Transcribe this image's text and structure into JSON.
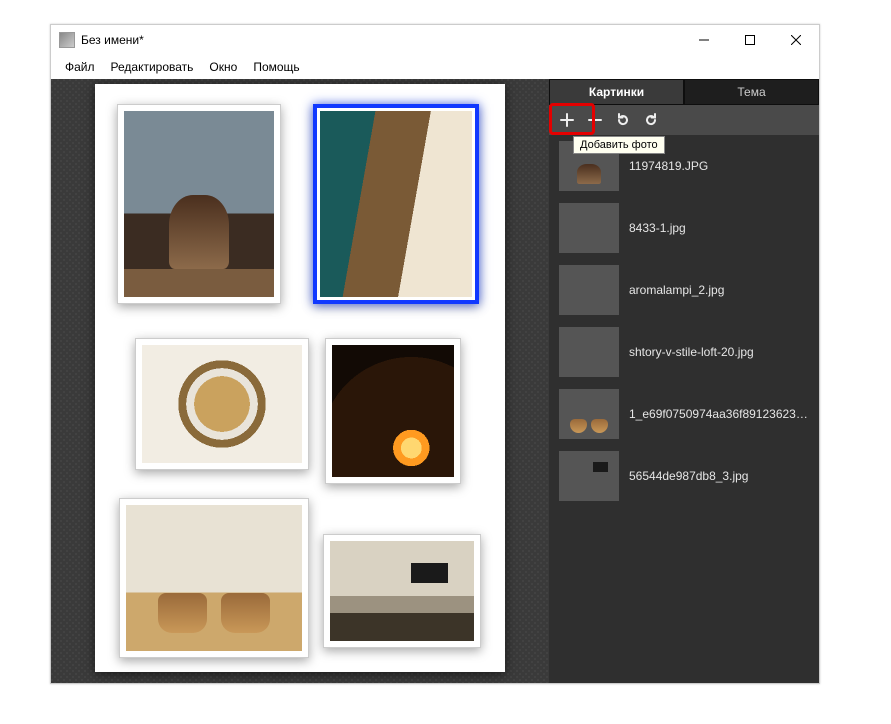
{
  "window": {
    "title": "Без имени*"
  },
  "menubar": {
    "file": "Файл",
    "edit": "Редактировать",
    "window": "Окно",
    "help": "Помощь"
  },
  "sidepanel": {
    "tabs": {
      "pictures": "Картинки",
      "theme": "Тема"
    },
    "toolbar": {
      "add_tooltip": "Добавить фото"
    },
    "files": [
      {
        "name": "11974819.JPG"
      },
      {
        "name": "8433-1.jpg"
      },
      {
        "name": "aromalampi_2.jpg"
      },
      {
        "name": "shtory-v-stile-loft-20.jpg"
      },
      {
        "name": "1_e69f0750974aa36f891236238e29"
      },
      {
        "name": "56544de987db8_3.jpg"
      }
    ]
  }
}
